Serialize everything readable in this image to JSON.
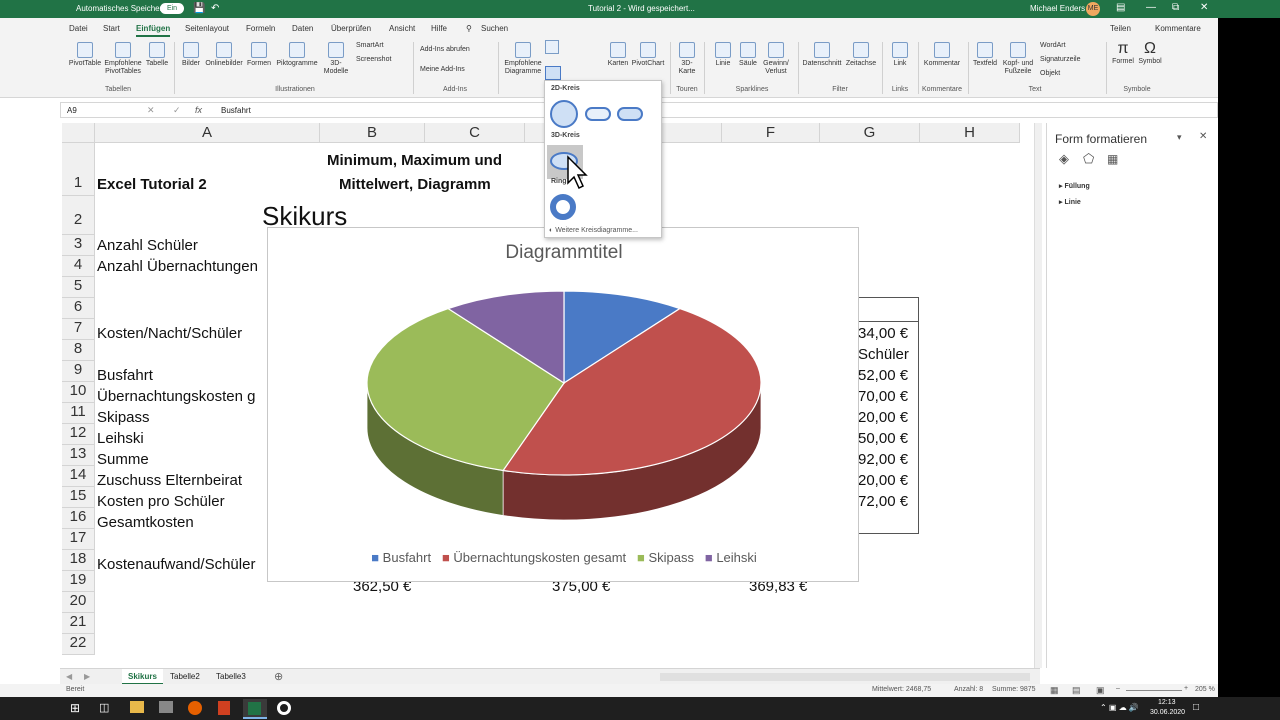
{
  "titlebar": {
    "autosave_label": "Automatisches Speichern",
    "autosave_state": "Ein",
    "doc_title": "Tutorial 2  -  Wird gespeichert...",
    "user_name": "Michael Enders",
    "user_initials": "ME"
  },
  "ribbon_tabs": [
    "Datei",
    "Start",
    "Einfügen",
    "Seitenlayout",
    "Formeln",
    "Daten",
    "Überprüfen",
    "Ansicht",
    "Hilfe"
  ],
  "search_label": "Suchen",
  "share_label": "Teilen",
  "comments_label": "Kommentare",
  "ribbon_buttons": {
    "pivottable": "PivotTable",
    "empfohlene_pivot": "Empfohlene PivotTables",
    "tabelle": "Tabelle",
    "bilder": "Bilder",
    "onlinebilder": "Onlinebilder",
    "formen": "Formen",
    "piktogramme": "Piktogramme",
    "modelle": "3D-Modelle",
    "smartart": "SmartArt",
    "screenshot": "Screenshot",
    "addins_abrufen": "Add-Ins abrufen",
    "meine_addins": "Meine Add-Ins",
    "empf_diagramme": "Empfohlene Diagramme",
    "karten": "Karten",
    "pivotchart": "PivotChart",
    "karte3d": "3D-Karte",
    "linie": "Linie",
    "saeule": "Säule",
    "gewinn": "Gewinn/ Verlust",
    "datenschnitt": "Datenschnitt",
    "zeitachse": "Zeitachse",
    "link": "Link",
    "kommentar": "Kommentar",
    "textfeld": "Textfeld",
    "kopfzeile": "Kopf- und Fußzeile",
    "wordart": "WordArt",
    "signaturzeile": "Signaturzeile",
    "objekt": "Objekt",
    "formel": "Formel",
    "symbol": "Symbol"
  },
  "ribbon_groups": [
    "Tabellen",
    "Illustrationen",
    "Add-Ins",
    "Touren",
    "Sparklines",
    "Filter",
    "Links",
    "Kommentare",
    "Text",
    "Symbole"
  ],
  "namebox": "A9",
  "formula_value": "Busfahrt",
  "columns": [
    "A",
    "B",
    "C",
    "E",
    "F",
    "G",
    "H"
  ],
  "rows": [
    "1",
    "2",
    "3",
    "4",
    "5",
    "6",
    "7",
    "8",
    "9",
    "10",
    "11",
    "12",
    "13",
    "14",
    "15",
    "16",
    "17",
    "18",
    "19",
    "20",
    "21",
    "22"
  ],
  "cells": {
    "a1": "Excel Tutorial 2",
    "b1_line1": "Minimum, Maximum und",
    "b1_line2": "Mittelwert, Diagramm",
    "a2": "Skikurs",
    "a3": "Anzahl Schüler",
    "a4": "Anzahl Übernachtungen",
    "a7": "Kosten/Nacht/Schüler",
    "a9": "Busfahrt",
    "a10": "Übernachtungskosten g",
    "a11": "Skipass",
    "a12": "Leihski",
    "a13": "Summe",
    "a14": "Zuschuss Elternbeirat",
    "a15": "Kosten pro Schüler",
    "a16": "Gesamtkosten",
    "a18": "Kostenaufwand/Schüler",
    "g7": "34,00 €",
    "g8": "Schüler",
    "g9": "52,00 €",
    "g10": "70,00 €",
    "g11": "20,00 €",
    "g12": "50,00 €",
    "g13": "92,00 €",
    "g14": "20,00 €",
    "g15": "72,00 €",
    "b19": "362,50 €",
    "d19": "375,00 €",
    "f19": "369,83 €"
  },
  "chart_data": {
    "type": "pie",
    "title": "Diagrammtitel",
    "categories": [
      "Busfahrt",
      "Übernachtungskosten gesamt",
      "Skipass",
      "Leihski"
    ],
    "values": [
      10,
      45,
      35,
      10
    ],
    "colors": [
      "#4a7ac6",
      "#c0504d",
      "#9bbb59",
      "#8064a2"
    ],
    "legend_position": "bottom"
  },
  "dropdown": {
    "section_2d": "2D-Kreis",
    "section_3d": "3D-Kreis",
    "section_ring": "Ring",
    "more_label": "Weitere Kreisdiagramme..."
  },
  "panel": {
    "title": "Form formatieren",
    "items": [
      "Füllung",
      "Linie"
    ]
  },
  "sheets": [
    "Skikurs",
    "Tabelle2",
    "Tabelle3"
  ],
  "status": {
    "ready": "Bereit",
    "mittelwert": "Mittelwert: 2468,75",
    "anzahl": "Anzahl: 8",
    "summe": "Summe: 9875",
    "zoom": "205 %"
  },
  "taskbar": {
    "time": "12:13",
    "date": "30.06.2020"
  }
}
